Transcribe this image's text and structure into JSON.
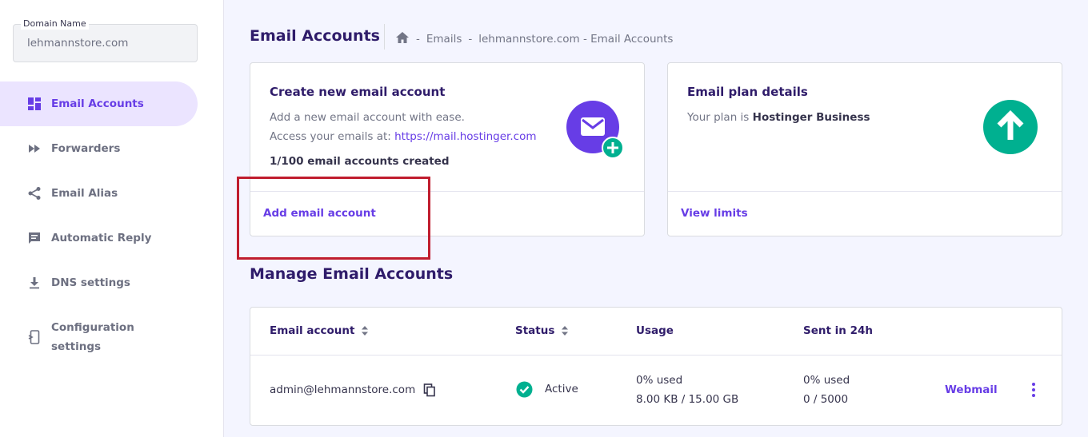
{
  "sidebar": {
    "domain_label": "Domain Name",
    "domain_value": "lehmannstore.com",
    "items": [
      {
        "label": "Email Accounts",
        "icon": "dashboard-icon",
        "active": true
      },
      {
        "label": "Forwarders",
        "icon": "fast-forward-icon"
      },
      {
        "label": "Email Alias",
        "icon": "share-icon"
      },
      {
        "label": "Automatic Reply",
        "icon": "comment-icon"
      },
      {
        "label": "DNS settings",
        "icon": "download-icon"
      },
      {
        "label": "Configuration settings",
        "icon": "settings-phone-icon"
      }
    ]
  },
  "header": {
    "title": "Email Accounts",
    "breadcrumb": {
      "home_icon": "home-icon",
      "sep": "-",
      "crumb1": "Emails",
      "crumb2": "lehmannstore.com - Email Accounts"
    }
  },
  "create_card": {
    "title": "Create new email account",
    "line1": "Add a new email account with ease.",
    "line2_prefix": "Access your emails at: ",
    "line2_link": "https://mail.hostinger.com",
    "count": "1/100 email accounts created",
    "action": "Add email account",
    "icon": "mail-add-icon"
  },
  "plan_card": {
    "title": "Email plan details",
    "text_prefix": "Your plan is ",
    "plan_name": "Hostinger Business",
    "action": "View limits",
    "icon": "arrow-up-icon"
  },
  "manage": {
    "title": "Manage Email Accounts",
    "columns": {
      "email": "Email account",
      "status": "Status",
      "usage": "Usage",
      "sent": "Sent in 24h"
    },
    "rows": [
      {
        "email": "admin@lehmannstore.com",
        "status": "Active",
        "usage_pct": "0% used",
        "usage_size": "8.00 KB / 15.00 GB",
        "sent_pct": "0% used",
        "sent_count": "0 / 5000",
        "action": "Webmail"
      }
    ]
  },
  "colors": {
    "primary": "#673de6",
    "success": "#00b090",
    "highlight": "#c01d2e",
    "title": "#2f1c6a"
  }
}
